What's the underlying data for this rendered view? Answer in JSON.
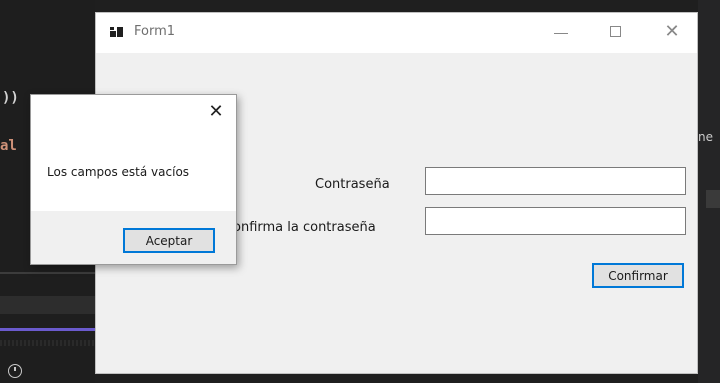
{
  "ide": {
    "code_line_1": "))",
    "code_line_2": "al",
    "right_text": "ne"
  },
  "form": {
    "title": "Form1",
    "password_label": "Contraseña",
    "confirm_password_label": "onfirma la contraseña",
    "password_value": "",
    "confirm_password_value": "",
    "confirm_button": "Confirmar",
    "close_symbol": "✕"
  },
  "message_box": {
    "text": "Los campos está vacíos",
    "ok_button": "Aceptar",
    "close_symbol": "✕"
  },
  "colors": {
    "accent": "#0078d7",
    "form_bg": "#f0f0f0",
    "ide_bg": "#1e1e1e"
  },
  "icons": [
    "app-icon",
    "minimize-icon",
    "maximize-icon",
    "close-icon",
    "clock-icon"
  ]
}
